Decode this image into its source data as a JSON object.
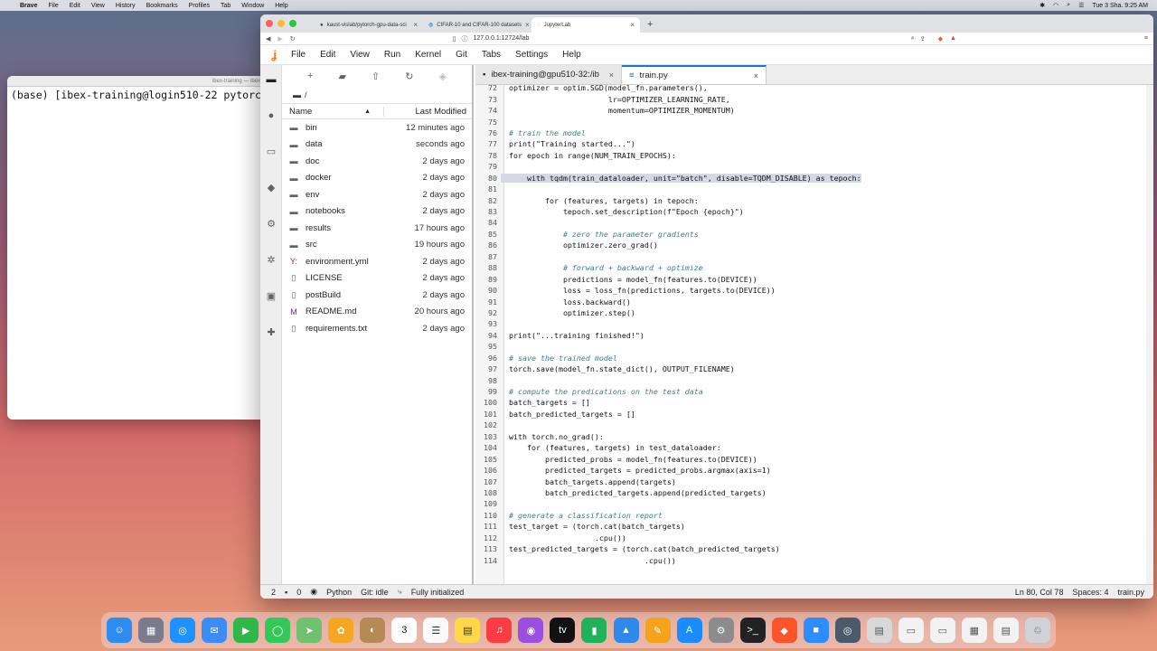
{
  "mac_menubar": {
    "app": "Brave",
    "items": [
      "File",
      "Edit",
      "View",
      "History",
      "Bookmarks",
      "Profiles",
      "Tab",
      "Window",
      "Help"
    ],
    "clock": "Tue 3 Sha. 9:25 AM"
  },
  "terminal": {
    "title": "ibex-training — ibex",
    "line": "(base) [ibex-training@login510-22 pytorch"
  },
  "browser": {
    "tabs": [
      {
        "label": "kaust-vislab/pytorch-gpu-data-sci",
        "icon": "github-icon"
      },
      {
        "label": "CIFAR-10 and CIFAR-100 datasets",
        "icon": "globe-icon"
      },
      {
        "label": "JupyterLab",
        "icon": "jupyter-icon"
      }
    ],
    "url": "127.0.0.1:12724/lab"
  },
  "jupyter": {
    "menu": [
      "File",
      "Edit",
      "View",
      "Run",
      "Kernel",
      "Git",
      "Tabs",
      "Settings",
      "Help"
    ],
    "filebrowser": {
      "crumb": "/",
      "header_name": "Name",
      "header_modified": "Last Modified",
      "items": [
        {
          "name": "bin",
          "modified": "12 minutes ago",
          "icon": "folder-icon"
        },
        {
          "name": "data",
          "modified": "seconds ago",
          "icon": "folder-icon"
        },
        {
          "name": "doc",
          "modified": "2 days ago",
          "icon": "folder-icon"
        },
        {
          "name": "docker",
          "modified": "2 days ago",
          "icon": "folder-icon"
        },
        {
          "name": "env",
          "modified": "2 days ago",
          "icon": "folder-icon"
        },
        {
          "name": "notebooks",
          "modified": "2 days ago",
          "icon": "folder-icon"
        },
        {
          "name": "results",
          "modified": "17 hours ago",
          "icon": "folder-icon"
        },
        {
          "name": "src",
          "modified": "19 hours ago",
          "icon": "folder-icon"
        },
        {
          "name": "environment.yml",
          "modified": "2 days ago",
          "icon": "yaml-icon"
        },
        {
          "name": "LICENSE",
          "modified": "2 days ago",
          "icon": "file-icon"
        },
        {
          "name": "postBuild",
          "modified": "2 days ago",
          "icon": "file-icon"
        },
        {
          "name": "README.md",
          "modified": "20 hours ago",
          "icon": "markdown-icon"
        },
        {
          "name": "requirements.txt",
          "modified": "2 days ago",
          "icon": "file-icon"
        }
      ]
    },
    "doc_tabs": [
      {
        "label": "ibex-training@gpu510-32:/ib",
        "icon": "terminal-icon"
      },
      {
        "label": "train.py",
        "icon": "python-icon"
      }
    ],
    "code": [
      {
        "n": "72",
        "t": "optimizer = optim.SGD(model_fn.parameters(),"
      },
      {
        "n": "73",
        "t": "                      lr=OPTIMIZER_LEARNING_RATE,"
      },
      {
        "n": "74",
        "t": "                      momentum=OPTIMIZER_MOMENTUM)"
      },
      {
        "n": "75",
        "t": ""
      },
      {
        "n": "76",
        "t": "# train the model"
      },
      {
        "n": "77",
        "t": "print(\"Training started...\")"
      },
      {
        "n": "78",
        "t": "for epoch in range(NUM_TRAIN_EPOCHS):"
      },
      {
        "n": "79",
        "t": ""
      },
      {
        "n": "80",
        "t": "    with tqdm(train_dataloader, unit=\"batch\", disable=TQDM_DISABLE) as tepoch:"
      },
      {
        "n": "81",
        "t": ""
      },
      {
        "n": "82",
        "t": "        for (features, targets) in tepoch:"
      },
      {
        "n": "83",
        "t": "            tepoch.set_description(f\"Epoch {epoch}\")"
      },
      {
        "n": "84",
        "t": ""
      },
      {
        "n": "85",
        "t": "            # zero the parameter gradients"
      },
      {
        "n": "86",
        "t": "            optimizer.zero_grad()"
      },
      {
        "n": "87",
        "t": ""
      },
      {
        "n": "88",
        "t": "            # forward + backward + optimize"
      },
      {
        "n": "89",
        "t": "            predictions = model_fn(features.to(DEVICE))"
      },
      {
        "n": "90",
        "t": "            loss = loss_fn(predictions, targets.to(DEVICE))"
      },
      {
        "n": "91",
        "t": "            loss.backward()"
      },
      {
        "n": "92",
        "t": "            optimizer.step()"
      },
      {
        "n": "93",
        "t": ""
      },
      {
        "n": "94",
        "t": "print(\"...training finished!\")"
      },
      {
        "n": "95",
        "t": ""
      },
      {
        "n": "96",
        "t": "# save the trained model"
      },
      {
        "n": "97",
        "t": "torch.save(model_fn.state_dict(), OUTPUT_FILENAME)"
      },
      {
        "n": "98",
        "t": ""
      },
      {
        "n": "99",
        "t": "# compute the predications on the test data"
      },
      {
        "n": "100",
        "t": "batch_targets = []"
      },
      {
        "n": "101",
        "t": "batch_predicted_targets = []"
      },
      {
        "n": "102",
        "t": ""
      },
      {
        "n": "103",
        "t": "with torch.no_grad():"
      },
      {
        "n": "104",
        "t": "    for (features, targets) in test_dataloader:"
      },
      {
        "n": "105",
        "t": "        predicted_probs = model_fn(features.to(DEVICE))"
      },
      {
        "n": "106",
        "t": "        predicted_targets = predicted_probs.argmax(axis=1)"
      },
      {
        "n": "107",
        "t": "        batch_targets.append(targets)"
      },
      {
        "n": "108",
        "t": "        batch_predicted_targets.append(predicted_targets)"
      },
      {
        "n": "109",
        "t": ""
      },
      {
        "n": "110",
        "t": "# generate a classification report"
      },
      {
        "n": "111",
        "t": "test_target = (torch.cat(batch_targets)"
      },
      {
        "n": "112",
        "t": "                   .cpu())"
      },
      {
        "n": "113",
        "t": "test_predicted_targets = (torch.cat(batch_predicted_targets)"
      },
      {
        "n": "114",
        "t": "                              .cpu())"
      }
    ],
    "highlighted_line": "80",
    "statusbar": {
      "terminals": "2",
      "kernels": "0",
      "language": "Python",
      "git": "Git: idle",
      "init": "Fully initialized",
      "cursor": "Ln 80, Col 78",
      "spaces": "Spaces: 4",
      "file": "train.py"
    }
  },
  "colors": {
    "jupyter_orange": "#f37726",
    "comment": "#408080",
    "keyword": "#008000",
    "string": "#ba2121",
    "selection": "#d5d9e6"
  }
}
